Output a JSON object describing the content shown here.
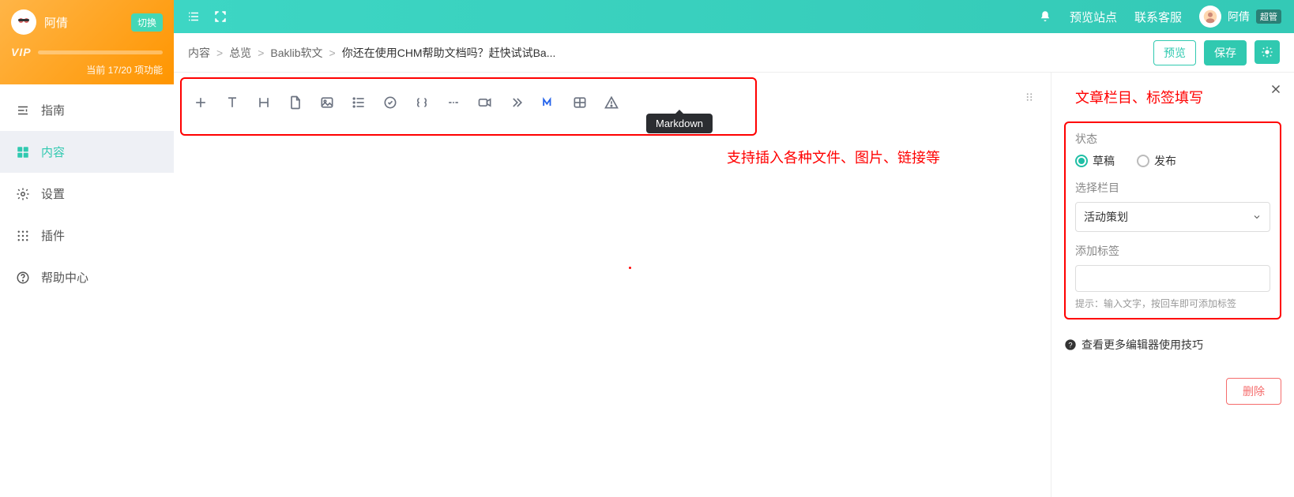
{
  "profile": {
    "name": "阿倩",
    "switch_label": "切换",
    "vip_label": "VIP",
    "status": "当前 17/20 项功能"
  },
  "nav": {
    "items": [
      {
        "icon": "guide",
        "label": "指南"
      },
      {
        "icon": "content",
        "label": "内容",
        "active": true
      },
      {
        "icon": "settings",
        "label": "设置"
      },
      {
        "icon": "plugins",
        "label": "插件"
      },
      {
        "icon": "help",
        "label": "帮助中心"
      }
    ]
  },
  "topbar": {
    "preview_site": "预览站点",
    "contact": "联系客服",
    "user_name": "阿倩",
    "role": "超管"
  },
  "breadcrumb": {
    "root": "内容",
    "l2": "总览",
    "l3": "Baklib软文",
    "current": "你还在使用CHM帮助文档吗？赶快试试Ba..."
  },
  "actions": {
    "preview": "预览",
    "save": "保存"
  },
  "tooltip": "Markdown",
  "editor_hint": "支持插入各种文件、图片、链接等",
  "rpanel": {
    "title": "文章栏目、标签填写",
    "status_label": "状态",
    "radio_draft": "草稿",
    "radio_publish": "发布",
    "category_label": "选择栏目",
    "category_value": "活动策划",
    "tags_label": "添加标签",
    "tags_hint": "提示：输入文字，按回车即可添加标签",
    "more_link": "查看更多编辑器使用技巧",
    "delete": "删除"
  }
}
